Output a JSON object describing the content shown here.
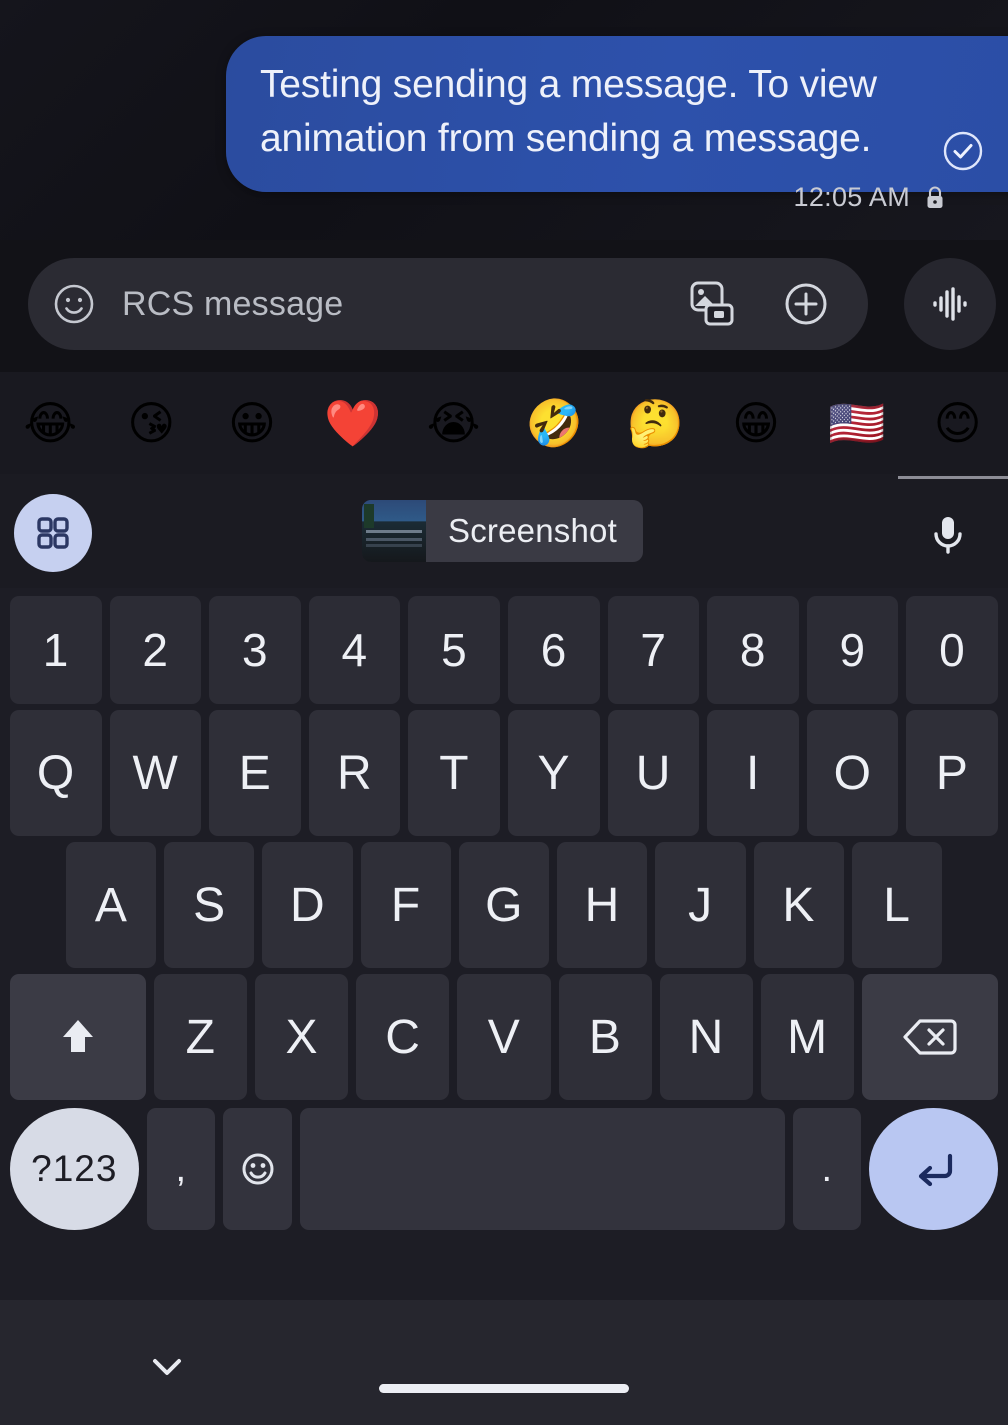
{
  "conversation": {
    "message": {
      "text": "Testing sending a message. To view animation from sending a message.",
      "bubble_color": "#2d51ab",
      "status_icon": "check-circle-icon",
      "timestamp": "12:05 AM",
      "encryption_icon": "lock-icon"
    }
  },
  "compose": {
    "emoji_button_icon": "smiley-face-icon",
    "placeholder": "RCS message",
    "gallery_icon": "gallery-camera-icon",
    "plus_icon": "plus-circle-icon",
    "audio_icon": "audio-waveform-icon"
  },
  "emoji_strip": {
    "items": [
      {
        "name": "emoji-face-with-tears-of-joy",
        "glyph": "😂"
      },
      {
        "name": "emoji-face-blowing-a-kiss",
        "glyph": "😘"
      },
      {
        "name": "emoji-grinning-face",
        "glyph": "😀"
      },
      {
        "name": "emoji-red-heart",
        "glyph": "❤️"
      },
      {
        "name": "emoji-loudly-crying-face",
        "glyph": "😭"
      },
      {
        "name": "emoji-rolling-on-the-floor-laughing",
        "glyph": "🤣"
      },
      {
        "name": "emoji-thinking-face",
        "glyph": "🤔"
      },
      {
        "name": "emoji-beaming-face-with-smiling-eyes",
        "glyph": "😁"
      },
      {
        "name": "emoji-flag-united-states",
        "glyph": "🇺🇸"
      },
      {
        "name": "emoji-smiling-face-with-smiling-eyes",
        "glyph": "😊"
      }
    ]
  },
  "suggestion_bar": {
    "grid_icon": "app-grid-icon",
    "clipboard_chip_label": "Screenshot",
    "mic_icon": "microphone-icon"
  },
  "keyboard": {
    "rows": {
      "numbers": [
        "1",
        "2",
        "3",
        "4",
        "5",
        "6",
        "7",
        "8",
        "9",
        "0"
      ],
      "top": [
        "Q",
        "W",
        "E",
        "R",
        "T",
        "Y",
        "U",
        "I",
        "O",
        "P"
      ],
      "home": [
        "A",
        "S",
        "D",
        "F",
        "G",
        "H",
        "J",
        "K",
        "L"
      ],
      "bottom_letters": [
        "Z",
        "X",
        "C",
        "V",
        "B",
        "N",
        "M"
      ]
    },
    "shift_icon": "shift-arrow-icon",
    "backspace_icon": "backspace-icon",
    "symbols_label": "?123",
    "comma_label": ",",
    "emoji_key_icon": "emoji-keyboard-icon",
    "space_label": "",
    "period_label": ".",
    "enter_icon": "enter-return-icon",
    "key_color": "#2f2f38",
    "modifier_color": "#3b3b45",
    "symbols_key_color": "#d7dbe6",
    "enter_key_color": "#b9c7f2"
  },
  "navigation": {
    "dismiss_keyboard_icon": "chevron-down-icon",
    "home_indicator": "home-gesture-bar"
  }
}
